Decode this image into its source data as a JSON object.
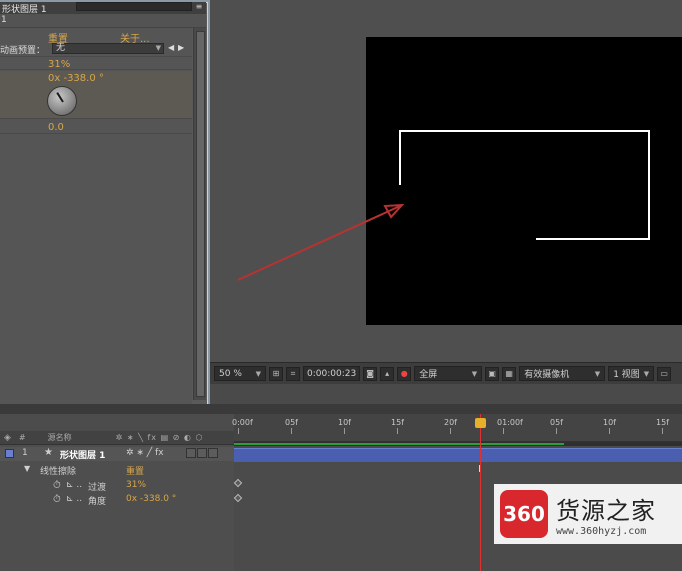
{
  "effects_panel": {
    "title": "形状图层 1",
    "subtitle": "1",
    "reset_label": "重置",
    "about_label": "关于...",
    "preset_label": "动画预置：",
    "preset_value": "无",
    "transition_value": "31%",
    "angle_value": "0x -338.0 °",
    "feather_value": "0.0"
  },
  "viewer_toolbar": {
    "zoom": "50 %",
    "timecode": "0:00:00:23",
    "resolution": "全屏",
    "camera": "有效摄像机",
    "views": "1 视图"
  },
  "timeline": {
    "header_source_name": "源名称",
    "layer_number": "1",
    "layer_name": "形状图层 1",
    "effect_name": "线性擦除",
    "effect_reset": "重置",
    "prop_transition_label": "过渡",
    "prop_transition_value": "31%",
    "prop_angle_label": "角度",
    "prop_angle_value": "0x -338.0 °",
    "ruler_labels": [
      "0:00f",
      "05f",
      "10f",
      "15f",
      "20f",
      "01:00f",
      "05f",
      "10f",
      "15f"
    ]
  },
  "watermark": {
    "logo_text": "360",
    "main_text": "货源之家",
    "url": "www.360hyzj.com"
  },
  "colors": {
    "accent_value": "#d8a64a",
    "layer_bar": "#4a5fb0",
    "cti": "#e03030",
    "work_area": "#2c9f3a"
  }
}
